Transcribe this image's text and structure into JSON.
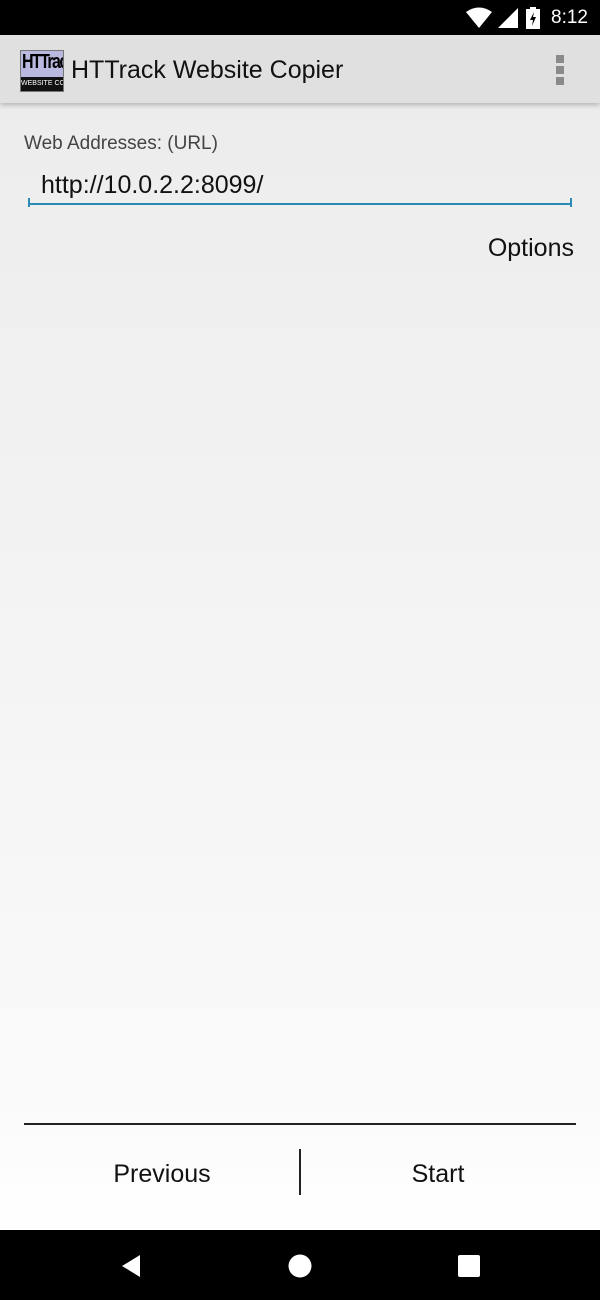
{
  "status_bar": {
    "time": "8:12",
    "icons": [
      "wifi-icon",
      "signal-icon",
      "battery-charging-icon"
    ]
  },
  "app_bar": {
    "title": "HTTrack Website Copier",
    "logo_text_top": "HTTrack",
    "logo_text_bottom": "WEBSITE COPIER",
    "menu_icon": "overflow-menu-icon"
  },
  "form": {
    "url_label": "Web Addresses: (URL)",
    "url_value": "http://10.0.2.2:8099/",
    "options_label": "Options"
  },
  "footer": {
    "previous_label": "Previous",
    "start_label": "Start"
  },
  "nav_bar": {
    "icons": [
      "back-icon",
      "home-icon",
      "recents-icon"
    ]
  },
  "colors": {
    "accent": "#2a8ab6",
    "app_bar": "#e0e0e0",
    "logo_bg": "#b9b8df"
  }
}
